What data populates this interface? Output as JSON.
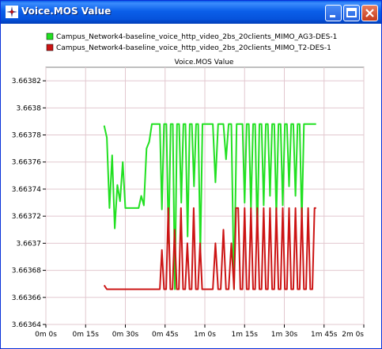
{
  "window": {
    "title": "Voice.MOS Value"
  },
  "colors": {
    "series1": "#22e022",
    "series2": "#cc1414",
    "grid": "#e2c8cf",
    "frame": "#808080"
  },
  "chart_data": {
    "type": "line",
    "title": "Voice.MOS Value",
    "xlabel": "",
    "ylabel": "",
    "x_unit": "seconds",
    "xlim": [
      0,
      120
    ],
    "ylim": [
      3.66364,
      3.66383
    ],
    "x_ticks": [
      0,
      15,
      30,
      45,
      60,
      75,
      90,
      105,
      120
    ],
    "x_tick_labels": [
      "0m 0s",
      "0m 15s",
      "0m 30s",
      "0m 45s",
      "1m 0s",
      "1m 15s",
      "1m 30s",
      "1m 45s",
      "2m 0s"
    ],
    "y_ticks": [
      3.66364,
      3.66366,
      3.66368,
      3.6637,
      3.66372,
      3.66374,
      3.66376,
      3.66378,
      3.6638,
      3.66382
    ],
    "y_tick_labels": [
      "3.66364",
      "3.66366",
      "3.66368",
      "3.6637",
      "3.66372",
      "3.66374",
      "3.66376",
      "3.66378",
      "3.6638",
      "3.66382"
    ],
    "grid": true,
    "legend_position": "top",
    "series": [
      {
        "name": "Campus_Network4-baseline_voice_http_video_2bs_20clients_MIMO_AG3-DES-1",
        "color": "#22e022",
        "points": [
          [
            22,
            3.663787
          ],
          [
            23,
            3.663778
          ],
          [
            24,
            3.663726
          ],
          [
            25,
            3.663765
          ],
          [
            26,
            3.663711
          ],
          [
            27,
            3.663743
          ],
          [
            28,
            3.663731
          ],
          [
            29,
            3.66376
          ],
          [
            30,
            3.663726
          ],
          [
            32,
            3.663726
          ],
          [
            34,
            3.663726
          ],
          [
            35,
            3.663726
          ],
          [
            36,
            3.663735
          ],
          [
            37,
            3.663728
          ],
          [
            38,
            3.66377
          ],
          [
            39,
            3.663775
          ],
          [
            40,
            3.663788
          ],
          [
            41,
            3.663788
          ],
          [
            42,
            3.663788
          ],
          [
            43,
            3.663788
          ],
          [
            43.8,
            3.663725
          ],
          [
            44.6,
            3.663788
          ],
          [
            45.5,
            3.663788
          ],
          [
            46.3,
            3.6637
          ],
          [
            47.1,
            3.663788
          ],
          [
            47.9,
            3.663788
          ],
          [
            48.7,
            3.663666
          ],
          [
            49.5,
            3.663788
          ],
          [
            50.3,
            3.663788
          ],
          [
            51.1,
            3.66373
          ],
          [
            51.9,
            3.663788
          ],
          [
            52.7,
            3.663788
          ],
          [
            53.5,
            3.663705
          ],
          [
            54.3,
            3.663788
          ],
          [
            55.1,
            3.663788
          ],
          [
            55.9,
            3.663742
          ],
          [
            56.7,
            3.663788
          ],
          [
            57.5,
            3.663788
          ],
          [
            58.3,
            3.663692
          ],
          [
            59.1,
            3.663788
          ],
          [
            62,
            3.663788
          ],
          [
            63,
            3.663788
          ],
          [
            64,
            3.663745
          ],
          [
            65,
            3.663788
          ],
          [
            67,
            3.663788
          ],
          [
            68,
            3.663762
          ],
          [
            69,
            3.663788
          ],
          [
            70,
            3.663788
          ],
          [
            71,
            3.663666
          ],
          [
            72,
            3.663788
          ],
          [
            74.2,
            3.663788
          ],
          [
            75,
            3.66373
          ],
          [
            75.8,
            3.663788
          ],
          [
            76.6,
            3.663788
          ],
          [
            77.4,
            3.663725
          ],
          [
            78.2,
            3.663788
          ],
          [
            79,
            3.663788
          ],
          [
            79.8,
            3.663705
          ],
          [
            80.6,
            3.663788
          ],
          [
            81.4,
            3.663788
          ],
          [
            82.2,
            3.663728
          ],
          [
            83,
            3.663788
          ],
          [
            83.8,
            3.663788
          ],
          [
            84.6,
            3.663735
          ],
          [
            85.4,
            3.663788
          ],
          [
            86.2,
            3.663788
          ],
          [
            87,
            3.66372
          ],
          [
            87.8,
            3.663788
          ],
          [
            88.6,
            3.663788
          ],
          [
            89.4,
            3.663728
          ],
          [
            90.2,
            3.663788
          ],
          [
            91,
            3.663788
          ],
          [
            91.8,
            3.663742
          ],
          [
            92.6,
            3.663788
          ],
          [
            93.4,
            3.663788
          ],
          [
            94.2,
            3.663735
          ],
          [
            95,
            3.663788
          ],
          [
            95.8,
            3.663788
          ],
          [
            96.6,
            3.663716
          ],
          [
            97.4,
            3.663788
          ],
          [
            98,
            3.663788
          ],
          [
            99,
            3.663788
          ],
          [
            100,
            3.663788
          ],
          [
            101,
            3.663788
          ],
          [
            102,
            3.663788
          ]
        ]
      },
      {
        "name": "Campus_Network4-baseline_voice_http_video_2bs_20clients_MIMO_T2-DES-1",
        "color": "#cc1414",
        "points": [
          [
            22,
            3.663669
          ],
          [
            23,
            3.663666
          ],
          [
            24,
            3.663666
          ],
          [
            30,
            3.663666
          ],
          [
            36,
            3.663666
          ],
          [
            40,
            3.663666
          ],
          [
            42,
            3.663666
          ],
          [
            43,
            3.663666
          ],
          [
            43.8,
            3.663695
          ],
          [
            44.6,
            3.663666
          ],
          [
            45.4,
            3.663666
          ],
          [
            46.2,
            3.663726
          ],
          [
            47,
            3.663666
          ],
          [
            47.8,
            3.663666
          ],
          [
            48.6,
            3.66371
          ],
          [
            49.4,
            3.663666
          ],
          [
            50.2,
            3.663666
          ],
          [
            51,
            3.663726
          ],
          [
            51.8,
            3.663666
          ],
          [
            52.6,
            3.663666
          ],
          [
            53.4,
            3.6637
          ],
          [
            54.2,
            3.663666
          ],
          [
            55,
            3.663666
          ],
          [
            55.8,
            3.663726
          ],
          [
            56.6,
            3.663666
          ],
          [
            57.4,
            3.663666
          ],
          [
            58.2,
            3.6637
          ],
          [
            59,
            3.663666
          ],
          [
            62,
            3.663666
          ],
          [
            63,
            3.663666
          ],
          [
            64,
            3.6637
          ],
          [
            65,
            3.663666
          ],
          [
            66,
            3.663666
          ],
          [
            67,
            3.66371
          ],
          [
            68,
            3.663666
          ],
          [
            69,
            3.663666
          ],
          [
            70,
            3.6637
          ],
          [
            71,
            3.663666
          ],
          [
            71.8,
            3.663726
          ],
          [
            72.6,
            3.663726
          ],
          [
            73.4,
            3.663666
          ],
          [
            74.2,
            3.663666
          ],
          [
            75,
            3.663726
          ],
          [
            75.8,
            3.663666
          ],
          [
            76.6,
            3.663666
          ],
          [
            77.4,
            3.663726
          ],
          [
            78.2,
            3.663666
          ],
          [
            79,
            3.663666
          ],
          [
            79.8,
            3.663726
          ],
          [
            80.6,
            3.663666
          ],
          [
            81.4,
            3.663666
          ],
          [
            82.2,
            3.663726
          ],
          [
            83,
            3.663666
          ],
          [
            83.8,
            3.663666
          ],
          [
            84.6,
            3.663726
          ],
          [
            85.4,
            3.663666
          ],
          [
            86.2,
            3.663666
          ],
          [
            87,
            3.663726
          ],
          [
            87.8,
            3.663666
          ],
          [
            88.6,
            3.663666
          ],
          [
            89.4,
            3.663726
          ],
          [
            90.2,
            3.663666
          ],
          [
            91,
            3.663666
          ],
          [
            91.8,
            3.663726
          ],
          [
            92.6,
            3.663666
          ],
          [
            93.4,
            3.663666
          ],
          [
            94.2,
            3.663726
          ],
          [
            95,
            3.663666
          ],
          [
            95.8,
            3.663666
          ],
          [
            96.6,
            3.663726
          ],
          [
            97.4,
            3.663666
          ],
          [
            98.2,
            3.663666
          ],
          [
            99,
            3.663726
          ],
          [
            99.8,
            3.663666
          ],
          [
            100.6,
            3.663666
          ],
          [
            101.4,
            3.663726
          ],
          [
            102,
            3.663726
          ]
        ]
      }
    ]
  }
}
